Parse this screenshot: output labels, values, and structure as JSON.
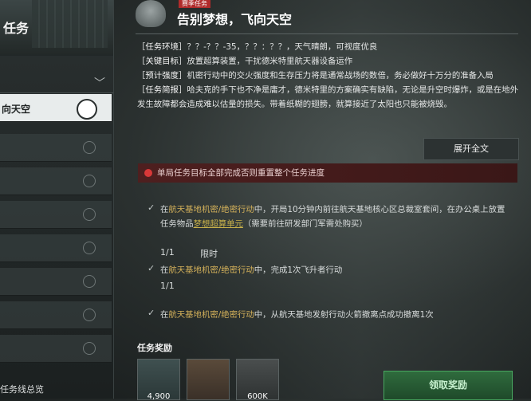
{
  "left_panel": {
    "title": "任务",
    "footer": "任务线总览",
    "items": [
      {
        "label": "向天空",
        "active": true
      },
      {
        "label": "",
        "active": false
      },
      {
        "label": "",
        "active": false
      },
      {
        "label": "",
        "active": false
      },
      {
        "label": "",
        "active": false
      },
      {
        "label": "",
        "active": false
      },
      {
        "label": "",
        "active": false
      },
      {
        "label": "",
        "active": false
      }
    ]
  },
  "header": {
    "tag": "赛季任务",
    "title": "告别梦想，飞向天空"
  },
  "info": {
    "env_label": "［任务环境］",
    "env_value": "？？-？？-35，？？：？？，天气晴朗，可视度优良",
    "goal_label": "［关键目标］",
    "goal_value": "放置超算装置，干扰德米特里航天器设备运作",
    "strength_label": "［预计强度］",
    "strength_value": "机密行动中的交火强度和生存压力将是通常战场的数倍，务必做好十万分的准备入局",
    "brief_label": "［任务简报］",
    "brief_value": "哈夫克的手下也不净是庸才，德米特里的方案确实有缺陷，无论是升空时爆炸，或是在地外发生故障都会造成难以估量的损失。带着纸糊的翅膀，就算接近了太阳也只能被烧毁。"
  },
  "expand_label": "展开全文",
  "warning": "单局任务目标全部完成否则重置整个任务进度",
  "tasks": [
    {
      "prefix": "在",
      "location": "航天基地机密/绝密行动",
      "middle": "中，开局10分钟内前往航天基地核心区总裁室套间，在办公桌上放置任务物品",
      "item": "梦想超算单元",
      "suffix": "（需要前往研发部门军需处购买）",
      "progress": "1/1",
      "limit": "限时"
    },
    {
      "prefix": "在",
      "location": "航天基地机密/绝密行动",
      "middle": "中，完成1次飞升者行动",
      "progress": "1/1"
    },
    {
      "prefix": "在",
      "location": "航天基地机密/绝密行动",
      "middle": "中，从航天基地发射行动火箭撤离点成功撤离1次"
    }
  ],
  "rewards": {
    "title": "任务奖励",
    "items": [
      {
        "value": "4,900",
        "icon": "experience-icon"
      },
      {
        "value": "",
        "icon": "equipment-case-icon"
      },
      {
        "value": "600K",
        "icon": "coin-icon"
      }
    ]
  },
  "claim_label": "领取奖励"
}
